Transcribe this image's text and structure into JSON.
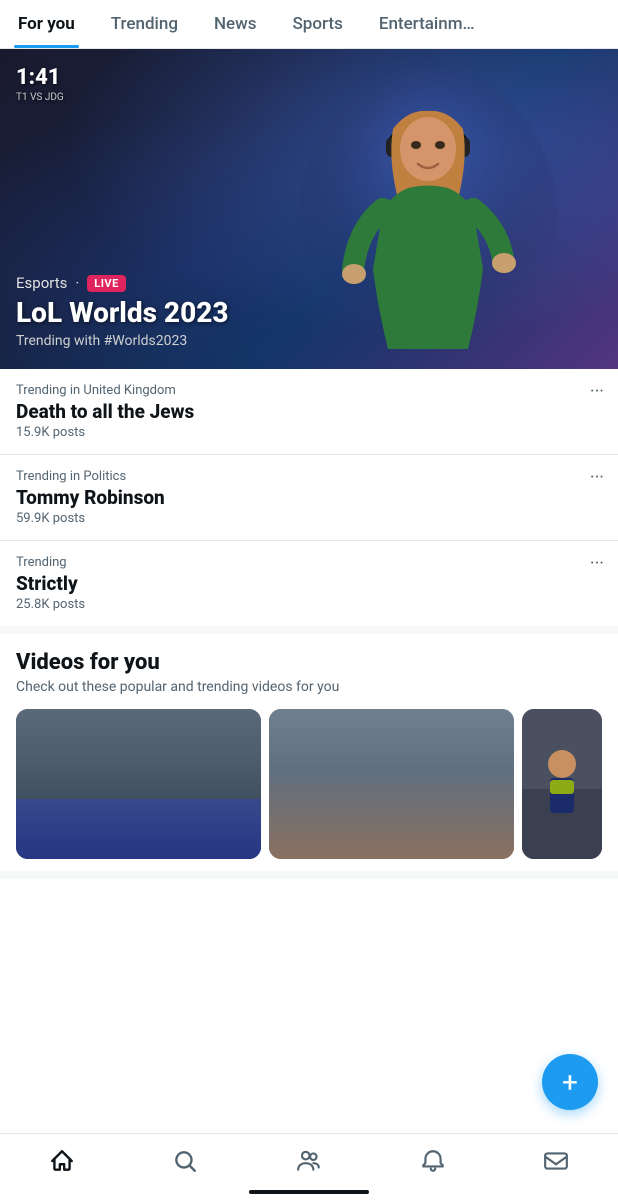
{
  "nav": {
    "items": [
      {
        "id": "for-you",
        "label": "For you",
        "active": true
      },
      {
        "id": "trending",
        "label": "Trending",
        "active": false
      },
      {
        "id": "news",
        "label": "News",
        "active": false
      },
      {
        "id": "sports",
        "label": "Sports",
        "active": false
      },
      {
        "id": "entertainment",
        "label": "Entertainm…",
        "active": false
      }
    ]
  },
  "video_banner": {
    "timer": "1:41",
    "timer_sub": "T1 VS JDG",
    "category": "Esports",
    "live_label": "LIVE",
    "title": "LoL Worlds 2023",
    "subtitle": "Trending with #Worlds2023"
  },
  "trending": {
    "items": [
      {
        "label": "Trending in United Kingdom",
        "topic": "Death to all the Jews",
        "posts": "15.9K posts"
      },
      {
        "label": "Trending in Politics",
        "topic": "Tommy Robinson",
        "posts": "59.9K posts"
      },
      {
        "label": "Trending",
        "topic": "Strictly",
        "posts": "25.8K posts"
      }
    ]
  },
  "videos_section": {
    "title": "Videos for you",
    "subtitle": "Check out these popular and trending videos for you"
  },
  "fab": {
    "label": "+"
  },
  "bottom_nav": {
    "items": [
      {
        "id": "home",
        "label": "home",
        "icon": "home"
      },
      {
        "id": "search",
        "label": "search",
        "icon": "search"
      },
      {
        "id": "people",
        "label": "people",
        "icon": "people"
      },
      {
        "id": "notifications",
        "label": "notifications",
        "icon": "bell"
      },
      {
        "id": "messages",
        "label": "messages",
        "icon": "mail"
      }
    ]
  }
}
